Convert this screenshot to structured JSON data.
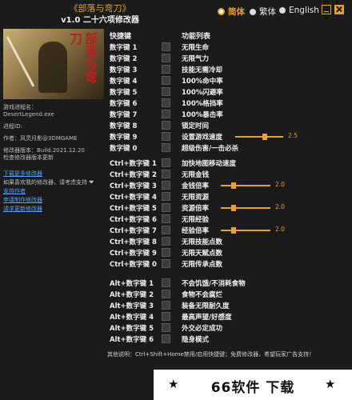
{
  "header": {
    "title": "《部落与弯刀》",
    "subtitle": "v1.0 二十六项修改器",
    "languages": [
      {
        "label": "简体",
        "active": true
      },
      {
        "label": "繁体",
        "active": false
      },
      {
        "label": "English",
        "active": false
      }
    ]
  },
  "sidebar": {
    "banner_text": "部落与弯刀",
    "process_label": "游戏进程名：",
    "process_name": "DesertLegend.exe",
    "pid_label": "进程ID:",
    "author": "作者：风灵月影@3DMGAME",
    "version": "修改器版本：Build.2021.12.20",
    "check_update": "检查修改器版本更新",
    "download_more": "下载更多修改器",
    "support_note": "如果喜欢我的修改器，请考虑支持 ❤",
    "support_author": "支持作者",
    "request_trainer": "申请制作修改器",
    "request_update": "请求更新修改器"
  },
  "table": {
    "col_hotkey": "快捷键",
    "col_function": "功能列表"
  },
  "rows": [
    {
      "key": "数字键 1",
      "label": "无限生命"
    },
    {
      "key": "数字键 2",
      "label": "无限气力"
    },
    {
      "key": "数字键 3",
      "label": "技能无需冷却"
    },
    {
      "key": "数字键 4",
      "label": "100%命中率"
    },
    {
      "key": "数字键 5",
      "label": "100%闪避率"
    },
    {
      "key": "数字键 6",
      "label": "100%格挡率"
    },
    {
      "key": "数字键 7",
      "label": "100%暴击率"
    },
    {
      "key": "数字键 8",
      "label": "锁定时间"
    },
    {
      "key": "数字键 9",
      "label": "设置游戏速度",
      "slider": "2.5",
      "fill": 0.62
    },
    {
      "key": "数字键 0",
      "label": "超级伤害/一击必杀"
    },
    {
      "key": "Ctrl+数字键 1",
      "label": "加快地图移动速度"
    },
    {
      "key": "Ctrl+数字键 2",
      "label": "无限金钱"
    },
    {
      "key": "Ctrl+数字键 3",
      "label": "金钱倍率",
      "slider": "2.0",
      "fill": 0.25
    },
    {
      "key": "Ctrl+数字键 4",
      "label": "无限资源"
    },
    {
      "key": "Ctrl+数字键 5",
      "label": "资源倍率",
      "slider": "2.0",
      "fill": 0.25
    },
    {
      "key": "Ctrl+数字键 6",
      "label": "无限经验"
    },
    {
      "key": "Ctrl+数字键 7",
      "label": "经验倍率",
      "slider": "2.0",
      "fill": 0.25
    },
    {
      "key": "Ctrl+数字键 8",
      "label": "无限技能点数"
    },
    {
      "key": "Ctrl+数字键 9",
      "label": "无限天赋点数"
    },
    {
      "key": "Ctrl+数字键 0",
      "label": "无限传承点数"
    },
    {
      "key": "Alt+数字键 1",
      "label": "不会饥饿/不消耗食物"
    },
    {
      "key": "Alt+数字键 2",
      "label": "食物不会腐烂"
    },
    {
      "key": "Alt+数字键 3",
      "label": "装备无限耐久度"
    },
    {
      "key": "Alt+数字键 4",
      "label": "最高声望/好感度"
    },
    {
      "key": "Alt+数字键 5",
      "label": "外交必定成功"
    },
    {
      "key": "Alt+数字键 6",
      "label": "隐身模式"
    }
  ],
  "footer": "其他说明：Ctrl+Shift+Home禁用/启用快捷键；免费修改器，希望玩家广告支持！",
  "watermark": "66软件 下载",
  "colors": {
    "accent": "#e8a030",
    "background": "#1b1b1b",
    "link": "#5aa0ff"
  }
}
